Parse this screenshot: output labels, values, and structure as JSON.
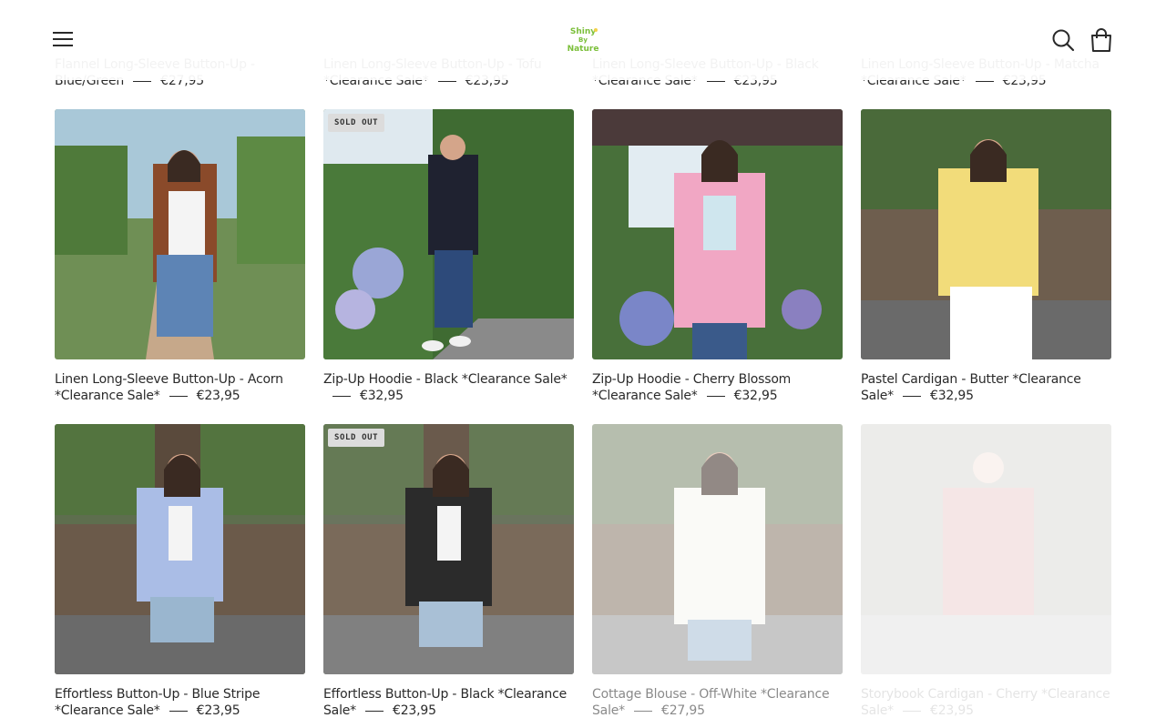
{
  "header": {
    "logo_text": "Shiny By Nature",
    "menu_icon": "hamburger-menu-icon",
    "search_icon": "search-icon",
    "cart_icon": "shopping-bag-icon"
  },
  "top_row": [
    {
      "title": "Flannel Long-Sleeve Button-Up - Blue/Green",
      "price": "€27,95"
    },
    {
      "title": "Linen Long-Sleeve Button-Up - Tofu *Clearance Sale*",
      "price": "€23,95"
    },
    {
      "title": "Linen Long-Sleeve Button-Up - Black *Clearance Sale*",
      "price": "€23,95"
    },
    {
      "title": "Linen Long-Sleeve Button-Up - Matcha *Clearance Sale*",
      "price": "€23,95"
    }
  ],
  "products": [
    {
      "title": "Linen Long-Sleeve Button-Up - Acorn *Clearance Sale*",
      "price": "€23,95",
      "badge": ""
    },
    {
      "title": "Zip-Up Hoodie - Black *Clearance Sale*",
      "price": "€32,95",
      "badge": "SOLD OUT"
    },
    {
      "title": "Zip-Up Hoodie - Cherry Blossom *Clearance Sale*",
      "price": "€32,95",
      "badge": ""
    },
    {
      "title": "Pastel Cardigan - Butter *Clearance Sale*",
      "price": "€32,95",
      "badge": ""
    },
    {
      "title": "Effortless Button-Up - Blue Stripe *Clearance Sale*",
      "price": "€23,95",
      "badge": ""
    },
    {
      "title": "Effortless Button-Up - Black *Clearance Sale*",
      "price": "€23,95",
      "badge": "SOLD OUT"
    },
    {
      "title": "Cottage Blouse - Off-White *Clearance Sale*",
      "price": "€27,95",
      "badge": ""
    },
    {
      "title": "Storybook Cardigan - Cherry *Clearance Sale*",
      "price": "€23,95",
      "badge": ""
    }
  ],
  "colors": {
    "text": "#2a2a2a",
    "badge_bg": "#dcdcdc",
    "logo_green": "#7bbf3a"
  }
}
